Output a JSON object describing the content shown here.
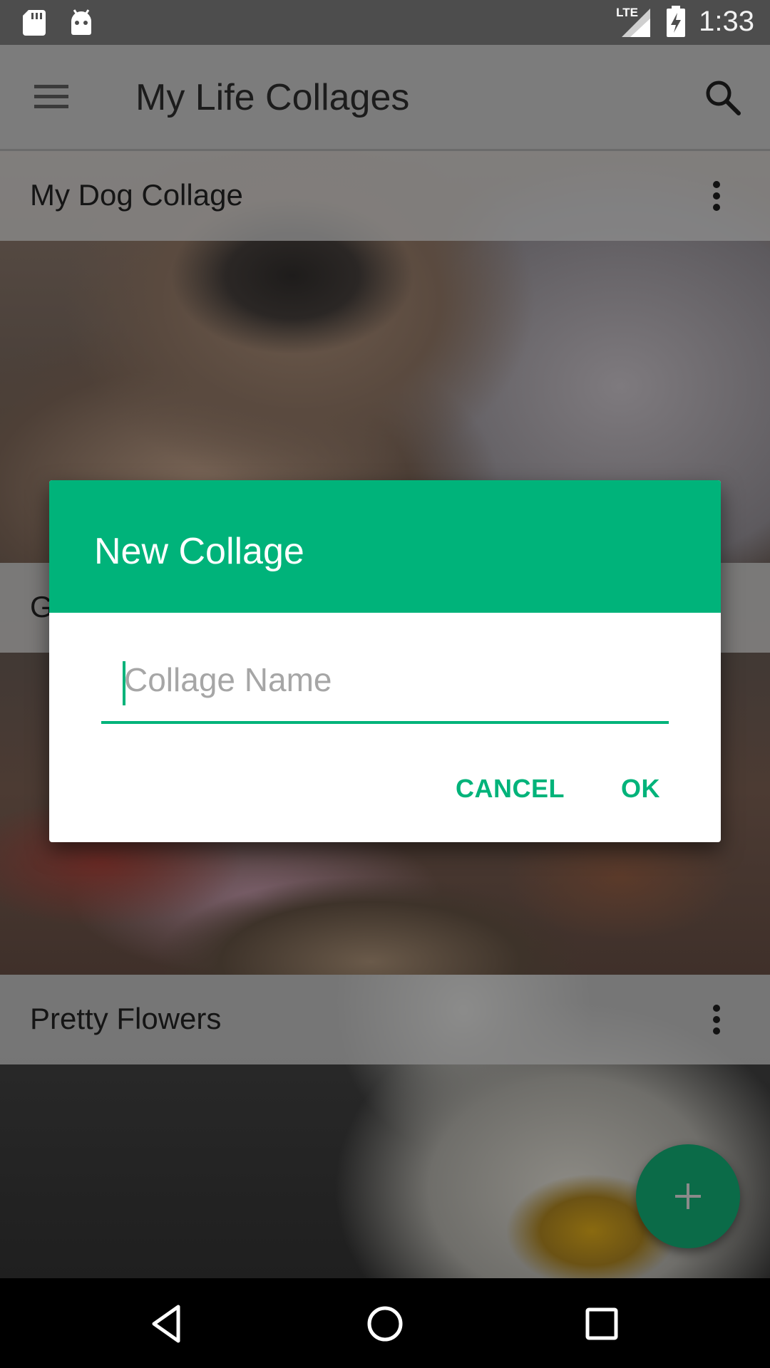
{
  "status_bar": {
    "time": "1:33",
    "network_label": "LTE",
    "icons": [
      "sd-card-icon",
      "android-icon",
      "lte-signal-icon",
      "battery-charging-icon"
    ]
  },
  "app_bar": {
    "title": "My Life Collages",
    "icons": [
      "menu-icon",
      "search-icon"
    ]
  },
  "collages": [
    {
      "name": "My Dog Collage"
    },
    {
      "name": "G"
    },
    {
      "name": "Pretty Flowers"
    }
  ],
  "dialog": {
    "title": "New Collage",
    "input_placeholder": "Collage Name",
    "input_value": "",
    "cancel_label": "CANCEL",
    "ok_label": "OK"
  },
  "fab": {
    "icon": "plus-icon"
  },
  "nav_bar": {
    "icons": [
      "back-icon",
      "home-icon",
      "recents-icon"
    ]
  },
  "colors": {
    "accent": "#00b37a",
    "fab": "#0b6b48",
    "status_bar": "#4d4d4d",
    "app_bar_dimmed": "#7c7c7c"
  }
}
